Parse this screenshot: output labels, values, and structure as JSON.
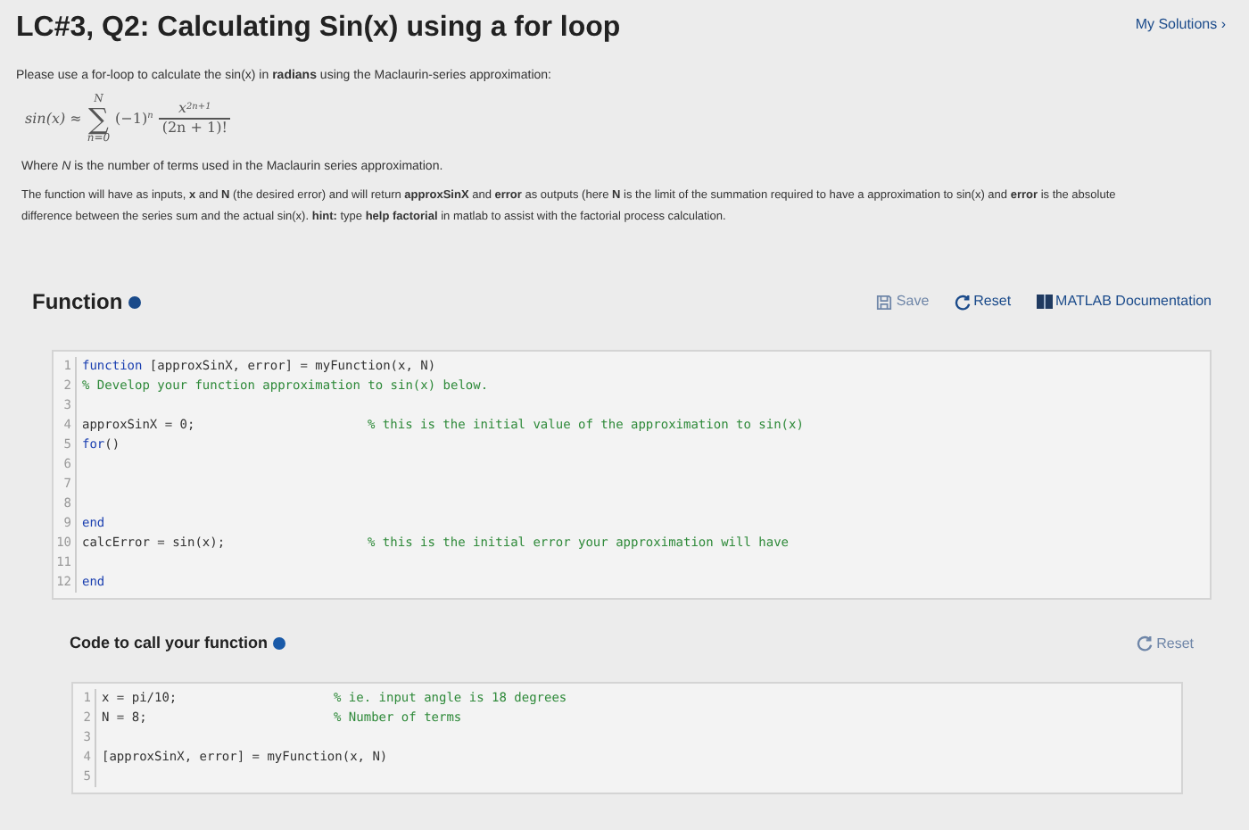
{
  "header": {
    "title": "LC#3, Q2: Calculating Sin(x) using a for loop",
    "link": "My Solutions ›"
  },
  "intro": "Please use a for-loop to calculate the sin(x) in **radians** using the Maclaurin-series approximation:",
  "formula": {
    "lhs": "sin(x) ≈",
    "sum": "∑",
    "upper": "N",
    "lower": "n=0",
    "sign": "(−1)",
    "sign_power": "n",
    "numerator": "x",
    "numerator_power": "2n+1",
    "denominator": "(2n + 1)!"
  },
  "where": "Where *N* is the number of terms used in the Maclaurin series approximation.",
  "description": "The function will have as inputs, **x** and **N** (the desired error) and will return **approxSinX** and **error** as outputs (here **N** is the limit of the summation required to have a approximation to sin(x) and  **error** is the absolute difference between the series sum and the actual sin(x). **hint:** type **help factorial** in matlab to assist with the factorial process calculation.",
  "function_section": {
    "heading": "Function",
    "actions": [
      {
        "kind": "save",
        "label": "Save",
        "disabled": true
      },
      {
        "kind": "reset",
        "label": "Reset",
        "disabled": false
      },
      {
        "kind": "docs",
        "label": "MATLAB Documentation",
        "disabled": false
      }
    ],
    "lines": [
      {
        "number": "1",
        "parts": [
          {
            "kind": "keyword",
            "text": "function"
          },
          {
            "kind": "plain",
            "text": " [approxSinX, error] = myFunction(x, N)"
          }
        ]
      },
      {
        "number": "2",
        "parts": [
          {
            "kind": "comment",
            "text": "% Develop your function approximation to sin(x) below."
          }
        ]
      },
      {
        "number": "3"
      },
      {
        "number": "4",
        "parts": [
          {
            "kind": "plain",
            "text": "approxSinX = 0;"
          }
        ],
        "note": "% this is the initial value of the approximation to sin(x)"
      },
      {
        "number": "5",
        "parts": [
          {
            "kind": "keyword",
            "text": "for"
          },
          {
            "kind": "plain",
            "text": "()"
          }
        ]
      },
      {
        "number": "6"
      },
      {
        "number": "7"
      },
      {
        "number": "8"
      },
      {
        "number": "9",
        "parts": [
          {
            "kind": "keyword",
            "text": "end"
          }
        ]
      },
      {
        "number": "10",
        "parts": [
          {
            "kind": "plain",
            "text": "calcError = sin(x);"
          }
        ],
        "note": "% this is the initial error your approximation will have"
      },
      {
        "number": "11"
      },
      {
        "number": "12",
        "parts": [
          {
            "kind": "keyword",
            "text": "end"
          }
        ]
      }
    ]
  },
  "call_section": {
    "heading": "Code to call your function",
    "actions": [
      {
        "kind": "reset",
        "label": "Reset",
        "disabled": true
      }
    ],
    "lines": [
      {
        "number": "1",
        "parts": [
          {
            "kind": "plain",
            "text": "x = pi/10;"
          }
        ],
        "note": "% ie. input angle is 18 degrees"
      },
      {
        "number": "2",
        "parts": [
          {
            "kind": "plain",
            "text": "N = 8;"
          }
        ],
        "note": "% Number of terms"
      },
      {
        "number": "3"
      },
      {
        "number": "4",
        "parts": [
          {
            "kind": "plain",
            "text": "[approxSinX, error] = myFunction(x, N)"
          }
        ]
      },
      {
        "number": "5"
      }
    ]
  }
}
